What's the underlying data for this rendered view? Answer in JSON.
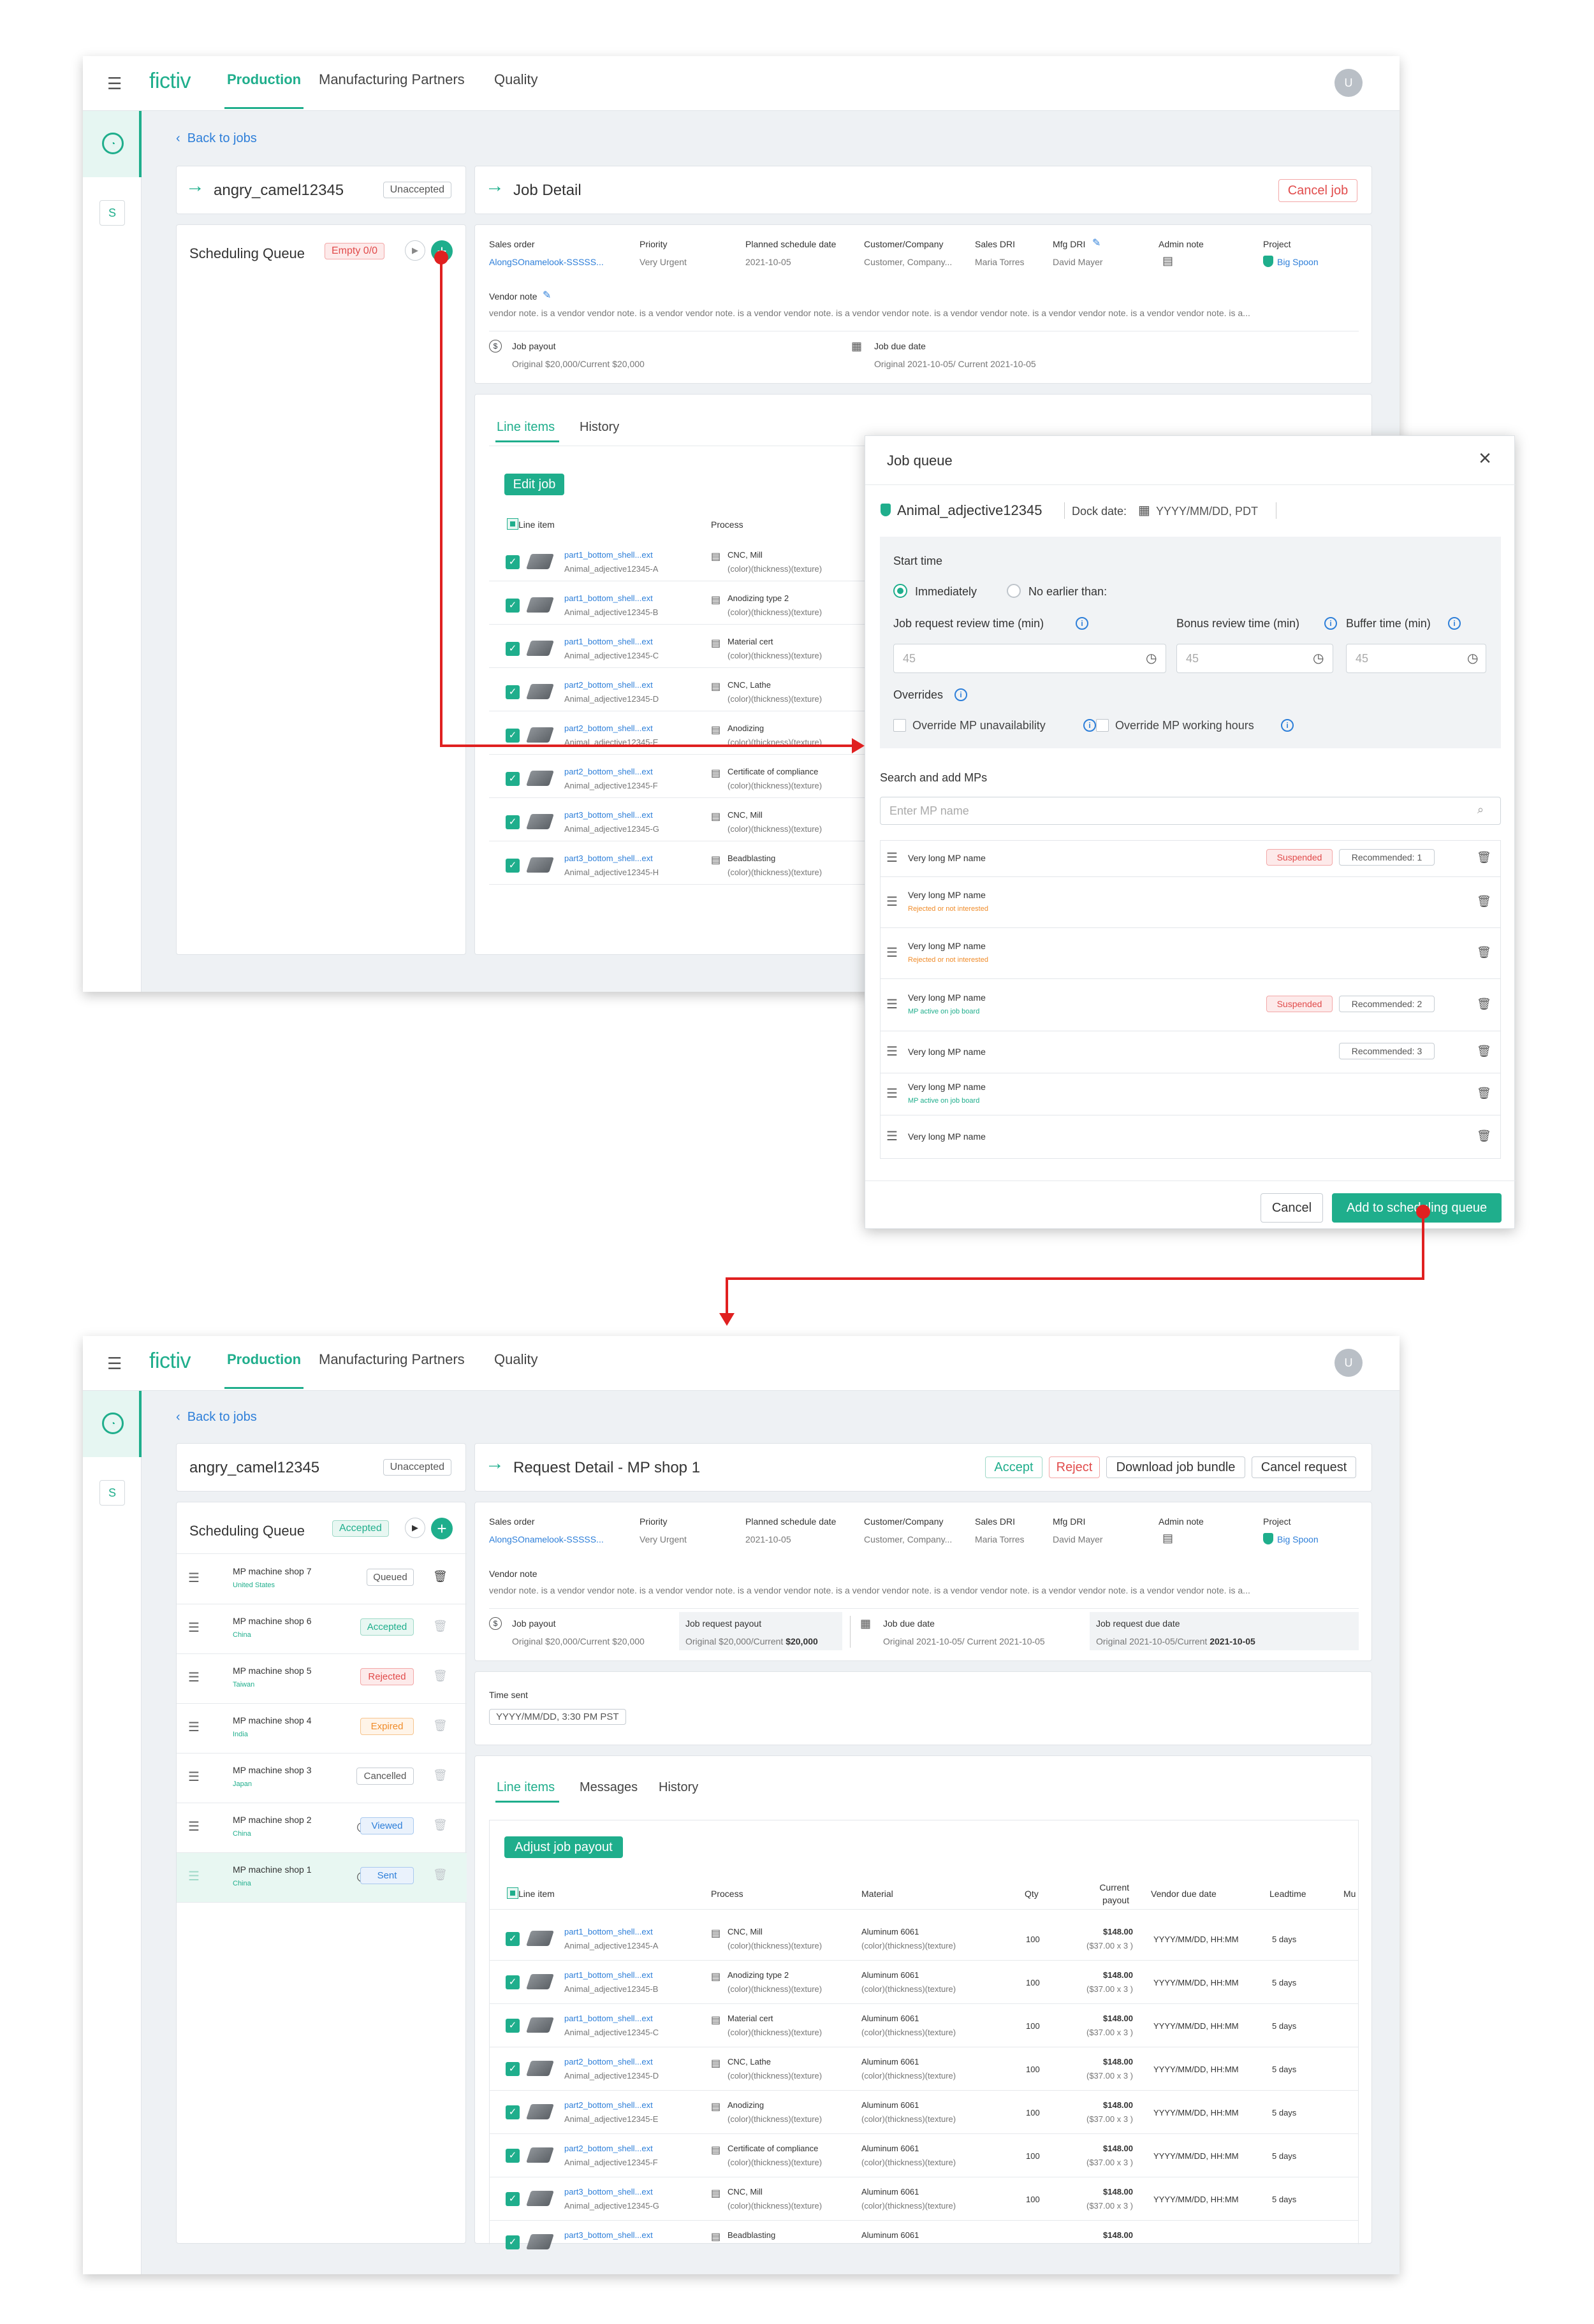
{
  "top": {
    "logo": "fictiv",
    "nav": [
      "Production",
      "Manufacturing Partners",
      "Quality"
    ],
    "avatar": "U",
    "back": "Back to jobs",
    "job_name": "angry_camel12345",
    "job_status": "Unaccepted",
    "job_detail_title": "Job Detail",
    "cancel_job": "Cancel job",
    "scheduling_queue": "Scheduling Queue",
    "queue_badge": "Empty 0/0",
    "fields": {
      "sales_order_label": "Sales order",
      "sales_order": "AlongSOnamelook-SSSSS...",
      "priority_label": "Priority",
      "priority": "Very Urgent",
      "planned_label": "Planned schedule date",
      "planned": "2021-10-05",
      "customer_label": "Customer/Company",
      "customer": "Customer, Company...",
      "sales_dri_label": "Sales DRI",
      "sales_dri": "Maria Torres",
      "mfg_dri_label": "Mfg DRI",
      "mfg_dri": "David Mayer",
      "admin_note_label": "Admin note",
      "project_label": "Project",
      "project": "Big Spoon",
      "vendor_note_label": "Vendor note",
      "vendor_note": "vendor note. is a vendor  vendor note. is a vendor  vendor note. is a vendor  vendor note. is a vendor  vendor note. is a vendor  vendor note. is a vendor  vendor note. is a vendor  vendor note. is a...",
      "job_payout_label": "Job payout",
      "job_payout": "Original $20,000/Current $20,000",
      "job_due_label": "Job due date",
      "job_due": "Original 2021-10-05/ Current 2021-10-05"
    },
    "tabs": [
      "Line items",
      "History"
    ],
    "edit_job": "Edit job",
    "col_line_item": "Line item",
    "col_process": "Process",
    "rows": [
      {
        "name": "part1_bottom_shell...ext",
        "sub": "Animal_adjective12345-A",
        "process": "CNC, Mill",
        "detail": "(color)(thickness)(texture)"
      },
      {
        "name": "part1_bottom_shell...ext",
        "sub": "Animal_adjective12345-B",
        "process": "Anodizing type 2",
        "detail": "(color)(thickness)(texture)"
      },
      {
        "name": "part1_bottom_shell...ext",
        "sub": "Animal_adjective12345-C",
        "process": "Material cert",
        "detail": "(color)(thickness)(texture)"
      },
      {
        "name": "part2_bottom_shell...ext",
        "sub": "Animal_adjective12345-D",
        "process": "CNC, Lathe",
        "detail": "(color)(thickness)(texture)"
      },
      {
        "name": "part2_bottom_shell...ext",
        "sub": "Animal_adjective12345-E",
        "process": "Anodizing",
        "detail": "(color)(thickness)(texture)"
      },
      {
        "name": "part2_bottom_shell...ext",
        "sub": "Animal_adjective12345-F",
        "process": "Certificate of compliance",
        "detail": "(color)(thickness)(texture)"
      },
      {
        "name": "part3_bottom_shell...ext",
        "sub": "Animal_adjective12345-G",
        "process": "CNC, Mill",
        "detail": "(color)(thickness)(texture)"
      },
      {
        "name": "part3_bottom_shell...ext",
        "sub": "Animal_adjective12345-H",
        "process": "Beadblasting",
        "detail": "(color)(thickness)(texture)"
      }
    ]
  },
  "modal": {
    "title": "Job queue",
    "job": "Animal_adjective12345",
    "dock_label": "Dock date:",
    "dock_value": "YYYY/MM/DD, PDT",
    "start_time": "Start time",
    "immediately": "Immediately",
    "no_earlier": "No earlier than:",
    "review_label": "Job request review time (min)",
    "bonus_label": "Bonus review time (min)",
    "buffer_label": "Buffer time (min)",
    "review_val": "45",
    "bonus_val": "45",
    "buffer_val": "45",
    "overrides": "Overrides",
    "override_unavail": "Override MP unavailability",
    "override_hours": "Override MP working hours",
    "search_label": "Search and add MPs",
    "search_placeholder": "Enter MP name",
    "mps": [
      {
        "name": "Very long MP name",
        "sub": "",
        "badges": [
          "Suspended",
          "Recommended: 1"
        ]
      },
      {
        "name": "Very long MP name",
        "sub": "Rejected or not interested",
        "badges": []
      },
      {
        "name": "Very long MP name",
        "sub": "Rejected or not interested",
        "badges": []
      },
      {
        "name": "Very long MP name",
        "sub": "MP active on job board",
        "badges": [
          "Suspended",
          "Recommended: 2"
        ]
      },
      {
        "name": "Very long MP name",
        "sub": "",
        "badges": [
          "Recommended: 3"
        ]
      },
      {
        "name": "Very long MP name",
        "sub": "MP active on job board",
        "badges": []
      },
      {
        "name": "Very long MP name",
        "sub": "",
        "badges": []
      }
    ],
    "cancel": "Cancel",
    "add": "Add to scheduling queue"
  },
  "bottom": {
    "logo": "fictiv",
    "nav": [
      "Production",
      "Manufacturing Partners",
      "Quality"
    ],
    "avatar": "U",
    "back": "Back to jobs",
    "job_name": "angry_camel12345",
    "job_status": "Unaccepted",
    "request_title": "Request Detail  - MP shop 1",
    "accept": "Accept",
    "reject": "Reject",
    "download": "Download job bundle",
    "cancel_request": "Cancel request",
    "scheduling_queue": "Scheduling Queue",
    "queue_badge": "Accepted",
    "queue": [
      {
        "name": "MP machine shop 7",
        "country": "United States",
        "status": "Queued"
      },
      {
        "name": "MP machine shop 6",
        "country": "China",
        "status": "Accepted"
      },
      {
        "name": "MP machine shop 5",
        "country": "Taiwan",
        "status": "Rejected"
      },
      {
        "name": "MP machine shop 4",
        "country": "India",
        "status": "Expired"
      },
      {
        "name": "MP machine shop 3",
        "country": "Japan",
        "status": "Cancelled"
      },
      {
        "name": "MP machine shop 2",
        "country": "China",
        "status": "Viewed"
      },
      {
        "name": "MP machine shop 1",
        "country": "China",
        "status": "Sent"
      }
    ],
    "fields": {
      "sales_order_label": "Sales order",
      "sales_order": "AlongSOnamelook-SSSSS...",
      "priority_label": "Priority",
      "priority": "Very Urgent",
      "planned_label": "Planned schedule date",
      "planned": "2021-10-05",
      "customer_label": "Customer/Company",
      "customer": "Customer, Company...",
      "sales_dri_label": "Sales DRI",
      "sales_dri": "Maria Torres",
      "mfg_dri_label": "Mfg DRI",
      "mfg_dri": "David Mayer",
      "admin_note_label": "Admin note",
      "project_label": "Project",
      "project": "Big Spoon",
      "vendor_note_label": "Vendor note",
      "vendor_note": "vendor note. is a vendor  vendor note. is a vendor  vendor note. is a vendor  vendor note. is a vendor  vendor note. is a vendor  vendor note. is a vendor  vendor note. is a vendor  vendor note. is a...",
      "job_payout_label": "Job payout",
      "job_payout": "Original $20,000/Current $20,000",
      "req_payout_label": "Job request payout",
      "req_payout": "Original $20,000/Current",
      "req_payout_bold": "$20,000",
      "job_due_label": "Job due date",
      "job_due": "Original 2021-10-05/ Current 2021-10-05",
      "req_due_label": "Job request due date",
      "req_due": "Original 2021-10-05/Current",
      "req_due_bold": "2021-10-05"
    },
    "time_sent_label": "Time sent",
    "time_sent": "YYYY/MM/DD, 3:30 PM PST",
    "tabs": [
      "Line items",
      "Messages",
      "History"
    ],
    "adjust": "Adjust job payout",
    "cols": [
      "Line item",
      "Process",
      "Material",
      "Qty",
      "Current payout",
      "Vendor due date",
      "Leadtime",
      "Mu"
    ],
    "rows": [
      {
        "name": "part1_bottom_shell...ext",
        "sub": "Animal_adjective12345-A",
        "process": "CNC, Mill",
        "detail": "(color)(thickness)(texture)",
        "material": "Aluminum 6061",
        "mdetail": "(color)(thickness)(texture)",
        "qty": "100",
        "pay": "$148.00",
        "paysub": "($37.00 x 3 )",
        "due": "YYYY/MM/DD, HH:MM",
        "lead": "5 days"
      },
      {
        "name": "part1_bottom_shell...ext",
        "sub": "Animal_adjective12345-B",
        "process": "Anodizing type 2",
        "detail": "(color)(thickness)(texture)",
        "material": "Aluminum 6061",
        "mdetail": "(color)(thickness)(texture)",
        "qty": "100",
        "pay": "$148.00",
        "paysub": "($37.00 x 3 )",
        "due": "YYYY/MM/DD, HH:MM",
        "lead": "5 days"
      },
      {
        "name": "part1_bottom_shell...ext",
        "sub": "Animal_adjective12345-C",
        "process": "Material cert",
        "detail": "(color)(thickness)(texture)",
        "material": "Aluminum 6061",
        "mdetail": "(color)(thickness)(texture)",
        "qty": "100",
        "pay": "$148.00",
        "paysub": "($37.00 x 3 )",
        "due": "YYYY/MM/DD, HH:MM",
        "lead": "5 days"
      },
      {
        "name": "part2_bottom_shell...ext",
        "sub": "Animal_adjective12345-D",
        "process": "CNC, Lathe",
        "detail": "(color)(thickness)(texture)",
        "material": "Aluminum 6061",
        "mdetail": "(color)(thickness)(texture)",
        "qty": "100",
        "pay": "$148.00",
        "paysub": "($37.00 x 3 )",
        "due": "YYYY/MM/DD, HH:MM",
        "lead": "5 days"
      },
      {
        "name": "part2_bottom_shell...ext",
        "sub": "Animal_adjective12345-E",
        "process": "Anodizing",
        "detail": "(color)(thickness)(texture)",
        "material": "Aluminum 6061",
        "mdetail": "(color)(thickness)(texture)",
        "qty": "100",
        "pay": "$148.00",
        "paysub": "($37.00 x 3 )",
        "due": "YYYY/MM/DD, HH:MM",
        "lead": "5 days"
      },
      {
        "name": "part2_bottom_shell...ext",
        "sub": "Animal_adjective12345-F",
        "process": "Certificate of compliance",
        "detail": "(color)(thickness)(texture)",
        "material": "Aluminum 6061",
        "mdetail": "(color)(thickness)(texture)",
        "qty": "100",
        "pay": "$148.00",
        "paysub": "($37.00 x 3 )",
        "due": "YYYY/MM/DD, HH:MM",
        "lead": "5 days"
      },
      {
        "name": "part3_bottom_shell...ext",
        "sub": "Animal_adjective12345-G",
        "process": "CNC, Mill",
        "detail": "(color)(thickness)(texture)",
        "material": "Aluminum 6061",
        "mdetail": "(color)(thickness)(texture)",
        "qty": "100",
        "pay": "$148.00",
        "paysub": "($37.00 x 3 )",
        "due": "YYYY/MM/DD, HH:MM",
        "lead": "5 days"
      },
      {
        "name": "part3_bottom_shell...ext",
        "sub": "",
        "process": "Beadblasting",
        "detail": "",
        "material": "Aluminum 6061",
        "mdetail": "",
        "qty": "",
        "pay": "$148.00",
        "paysub": "",
        "due": "",
        "lead": ""
      }
    ]
  },
  "colors": {
    "brand": "#1fae8c",
    "link": "#2e7fd9",
    "flow": "#e02020"
  }
}
